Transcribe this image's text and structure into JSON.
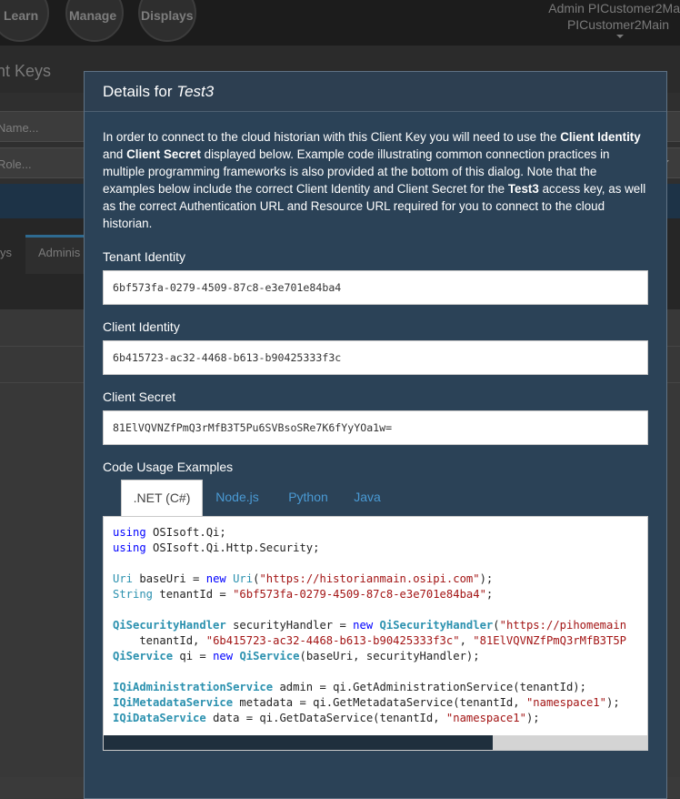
{
  "background": {
    "nav": [
      "Learn",
      "Manage",
      "Displays"
    ],
    "user": {
      "name": "Admin PICustomer2Ma",
      "tenant": "PICustomer2Main"
    },
    "page_title": "nt Keys",
    "filters": {
      "name_placeholder": "Name...",
      "role_placeholder": "Role..."
    },
    "tabs": [
      "ys",
      "Adminis"
    ]
  },
  "modal": {
    "title_prefix": "Details for ",
    "title_key": "Test3",
    "intro": {
      "p1": "In order to connect to the cloud historian with this Client Key you will need to use the ",
      "b1": "Client Identity",
      "p2": " and ",
      "b2": "Client Secret",
      "p3": " displayed below. Example code illustrating common connection practices in multiple programming frameworks is also provided at the bottom of this dialog. Note that the examples below include the correct Client Identity and Client Secret for the ",
      "b3": "Test3",
      "p4": " access key, as well as the correct Authentication URL and Resource URL required for you to connect to the cloud historian."
    },
    "fields": {
      "tenant": {
        "label": "Tenant Identity",
        "value": "6bf573fa-0279-4509-87c8-e3e701e84ba4"
      },
      "client": {
        "label": "Client Identity",
        "value": "6b415723-ac32-4468-b613-b90425333f3c"
      },
      "secret": {
        "label": "Client Secret",
        "value": "81ElVQVNZfPmQ3rMfB3T5Pu6SVBsoSRe7K6fYyYOa1w="
      }
    },
    "code_section_label": "Code Usage Examples",
    "code_tabs": [
      ".NET (C#)",
      "Node.js",
      "Python",
      "Java"
    ],
    "active_tab": ".NET (C#)",
    "code": {
      "using1_kw": "using",
      "using1_rest": " OSIsoft.Qi;",
      "using2_kw": "using",
      "using2_rest": " OSIsoft.Qi.Http.Security;",
      "uri_type": "Uri",
      "uri_mid": " baseUri = ",
      "uri_new": "new",
      "uri_type2": "Uri",
      "uri_open": "(",
      "uri_str": "\"https://historianmain.osipi.com\"",
      "uri_close": ");",
      "str_type": "String",
      "str_mid": " tenantId = ",
      "str_val": "\"6bf573fa-0279-4509-87c8-e3e701e84ba4\"",
      "str_end": ";",
      "sec_type": "QiSecurityHandler",
      "sec_mid": " securityHandler = ",
      "sec_new": "new",
      "sec_type2": "QiSecurityHandler",
      "sec_open": "(",
      "sec_str": "\"https://pihomemain",
      "sec2_pre": "    tenantId, ",
      "sec2_str1": "\"6b415723-ac32-4468-b613-b90425333f3c\"",
      "sec2_comma": ", ",
      "sec2_str2": "\"81ElVQVNZfPmQ3rMfB3T5P",
      "svc_type": "QiService",
      "svc_mid": " qi = ",
      "svc_new": "new",
      "svc_type2": "QiService",
      "svc_rest": "(baseUri, securityHandler);",
      "adm_type": "IQiAdministrationService",
      "adm_rest": " admin = qi.GetAdministrationService(tenantId);",
      "meta_type": "IQiMetadataService",
      "meta_rest": " metadata = qi.GetMetadataService(tenantId, ",
      "meta_str": "\"namespace1\"",
      "meta_end": ");",
      "data_type": "IQiDataService",
      "data_rest": " data = qi.GetDataService(tenantId, ",
      "data_str": "\"namespace1\"",
      "data_end": ");"
    }
  }
}
